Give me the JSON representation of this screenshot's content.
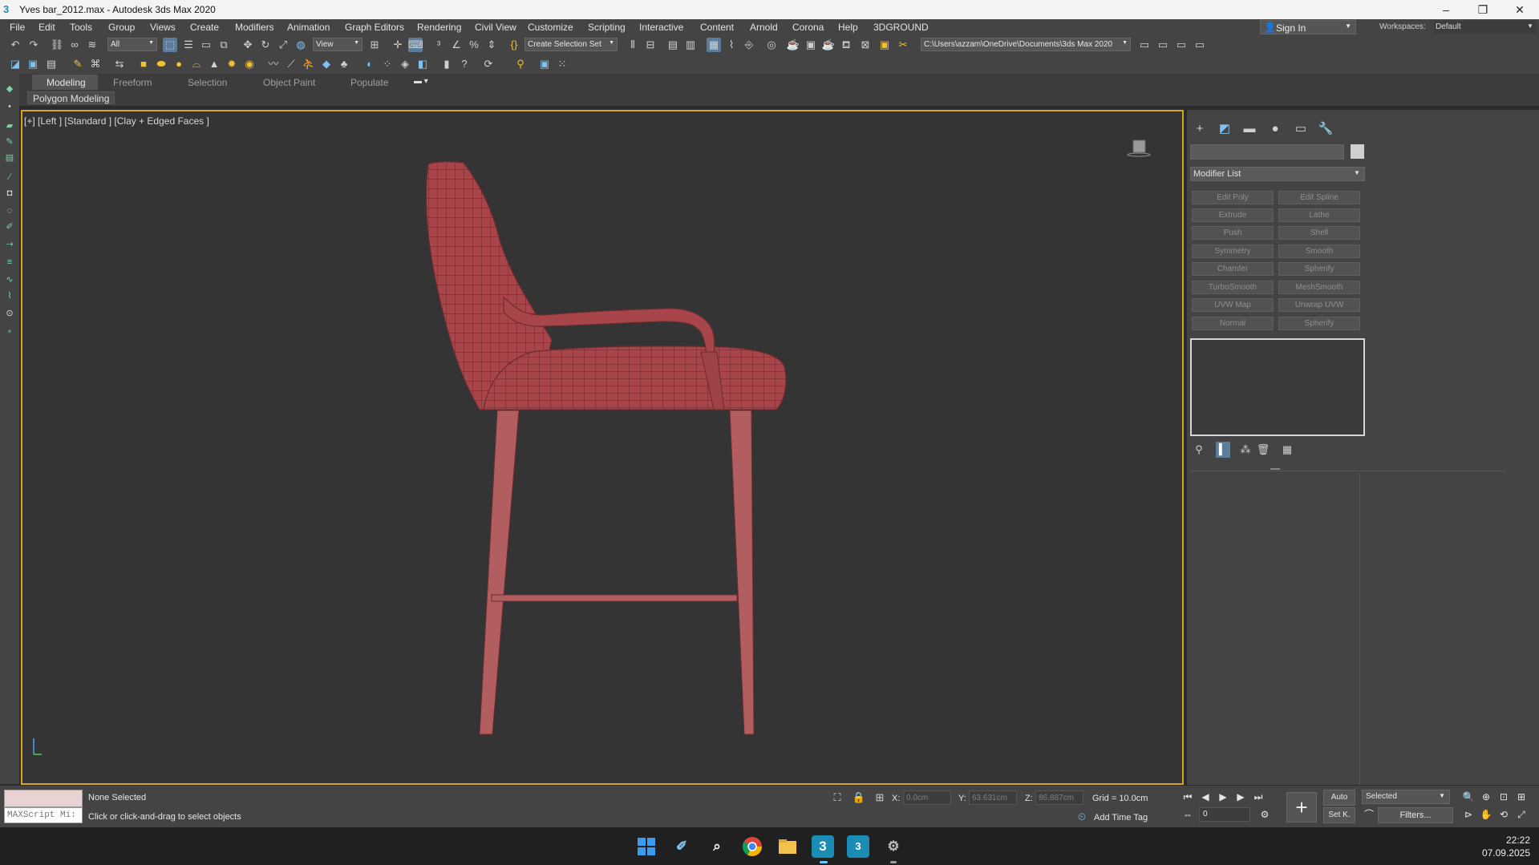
{
  "window": {
    "title": "Yves bar_2012.max - Autodesk 3ds Max 2020",
    "app_icon": "3",
    "minimize": "–",
    "restore": "❐",
    "close": "✕"
  },
  "menu": {
    "items": [
      "File",
      "Edit",
      "Tools",
      "Group",
      "Views",
      "Create",
      "Modifiers",
      "Animation",
      "Graph Editors",
      "Rendering",
      "Civil View",
      "Customize",
      "Scripting",
      "Interactive",
      "Content",
      "Arnold",
      "Corona",
      "Help",
      "3DGROUND"
    ],
    "sign_in": "Sign In",
    "workspaces_label": "Workspaces:",
    "workspace_value": "Default"
  },
  "toolbar": {
    "selection_filter": "All",
    "reference_coord": "View",
    "named_selection": "Create Selection Set",
    "project_path": "C:\\Users\\azzam\\OneDrive\\Documents\\3ds Max 2020"
  },
  "ribbon": {
    "tabs": [
      "Modeling",
      "Freeform",
      "Selection",
      "Object Paint",
      "Populate"
    ],
    "active_tab": "Modeling",
    "panel": "Polygon Modeling"
  },
  "viewport": {
    "label": "[+] [Left ] [Standard ] [Clay + Edged Faces ]",
    "model_color": "#a8454a",
    "border_color": "#d8a41f"
  },
  "command_panel": {
    "modifier_list": "Modifier List",
    "modifier_buttons": [
      "Edit Poly",
      "Edit Spline",
      "Extrude",
      "Lathe",
      "Push",
      "Shell",
      "Symmetry",
      "Smooth",
      "Chamfer",
      "Spherify",
      "TurboSmooth",
      "MeshSmooth",
      "UVW Map",
      "Unwrap UVW",
      "Normal",
      "Spherify"
    ]
  },
  "status": {
    "selection": "None Selected",
    "prompt": "Click or click-and-drag to select objects",
    "maxscript": "MAXScript Mi:",
    "x_label": "X:",
    "x_value": "0.0cm",
    "y_label": "Y:",
    "y_value": "63.631cm",
    "z_label": "Z:",
    "z_value": "86.887cm",
    "grid": "Grid = 10.0cm",
    "add_time_tag": "Add Time Tag",
    "auto_key": "Auto",
    "set_key": "Set K.",
    "key_mode": "Selected",
    "filters": "Filters...",
    "frame": "0"
  },
  "taskbar": {
    "time": "22:22",
    "date": "07.09.2025"
  }
}
